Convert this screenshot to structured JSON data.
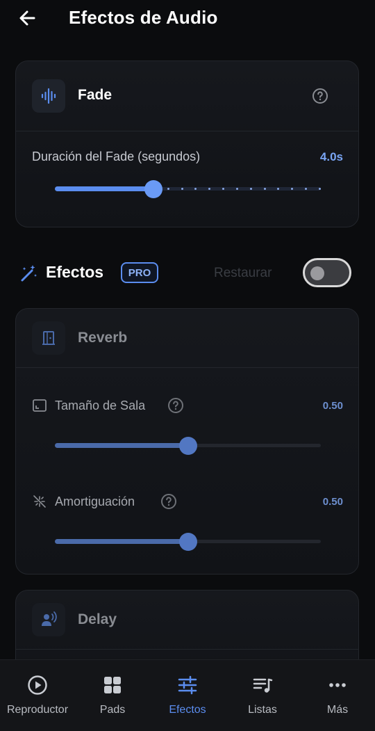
{
  "header": {
    "title": "Efectos de Audio",
    "back_icon": "arrow-left-icon"
  },
  "fade": {
    "title": "Fade",
    "icon": "waveform-icon",
    "duration_label": "Duración del Fade (segundos)",
    "duration_value": "4.0s",
    "slider_fraction": 0.37
  },
  "effects": {
    "title": "Efectos",
    "badge": "PRO",
    "restore_label": "Restaurar",
    "toggle_on": false
  },
  "reverb": {
    "title": "Reverb",
    "icon": "door-icon",
    "room_size": {
      "label": "Tamaño de Sala",
      "value": "0.50",
      "fraction": 0.5
    },
    "damping": {
      "label": "Amortiguación",
      "value": "0.50",
      "fraction": 0.5
    }
  },
  "delay": {
    "title": "Delay",
    "icon": "voice-icon"
  },
  "nav": {
    "items": [
      {
        "label": "Reproductor",
        "icon": "play-circle-icon"
      },
      {
        "label": "Pads",
        "icon": "grid-icon"
      },
      {
        "label": "Efectos",
        "icon": "sliders-icon",
        "active": true
      },
      {
        "label": "Listas",
        "icon": "playlist-icon"
      },
      {
        "label": "Más",
        "icon": "more-icon"
      }
    ]
  },
  "colors": {
    "accent": "#5b8def",
    "background": "#0b0c0e"
  }
}
